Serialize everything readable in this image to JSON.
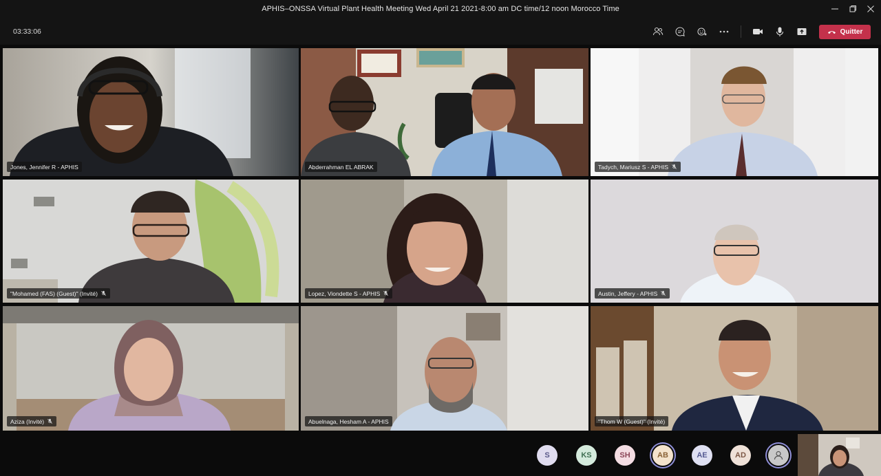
{
  "window": {
    "title": "APHIS–ONSSA Virtual Plant Health Meeting Wed April 21 2021-8:00 am DC time/12 noon Morocco Time"
  },
  "toolbar": {
    "timer": "03:33:06",
    "icons": [
      "people-icon",
      "chat-icon",
      "reactions-icon",
      "more-icon",
      "camera-icon",
      "mic-icon",
      "share-icon"
    ],
    "leave_label": "Quitter",
    "leave_color": "#c4314b"
  },
  "participants": [
    {
      "name": "Jones, Jennifer R - APHIS",
      "muted": false
    },
    {
      "name": "Abderrahman EL ABRAK",
      "muted": false
    },
    {
      "name": "Tadych, Mariusz S - APHIS",
      "muted": true
    },
    {
      "name": "\"Mohamed (FAS) (Guest)\" (Invité)",
      "muted": true
    },
    {
      "name": "Lopez, Viondette S - APHIS",
      "muted": true
    },
    {
      "name": "Austin, Jeffery - APHIS",
      "muted": true
    },
    {
      "name": "Aziza (Invité)",
      "muted": true
    },
    {
      "name": "Abuelnaga, Hesham A - APHIS",
      "muted": false
    },
    {
      "name": "\"Thom W (Guest)\" (Invité)",
      "muted": false
    }
  ],
  "overflow_avatars": [
    {
      "initials": "S",
      "bg": "#e0dcef",
      "fg": "#5b5a8a"
    },
    {
      "initials": "KS",
      "bg": "#d4eadc",
      "fg": "#3f6e52"
    },
    {
      "initials": "SH",
      "bg": "#f4dde3",
      "fg": "#8c4759"
    },
    {
      "initials": "AB",
      "bg": "#f4e3cd",
      "fg": "#8a6236",
      "active": true
    },
    {
      "initials": "AE",
      "bg": "#dfe0f2",
      "fg": "#555a92"
    },
    {
      "initials": "AD",
      "bg": "#efe1d8",
      "fg": "#7d5846"
    },
    {
      "initials": "",
      "bg": "#c8c8c8",
      "fg": "#555555",
      "icon": "person-icon",
      "active": true
    }
  ],
  "accent_color": "#8f8fd8"
}
